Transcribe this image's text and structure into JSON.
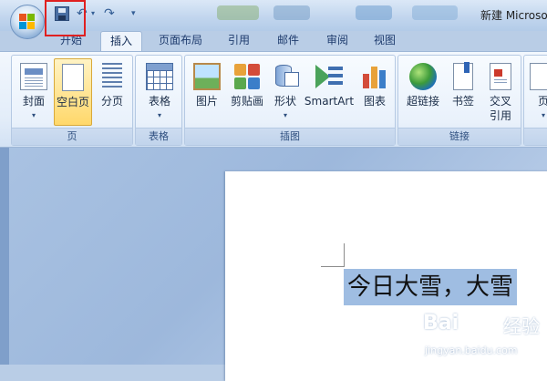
{
  "window": {
    "title": "新建 Microso"
  },
  "tabs": [
    {
      "label": "开始"
    },
    {
      "label": "插入"
    },
    {
      "label": "页面布局"
    },
    {
      "label": "引用"
    },
    {
      "label": "邮件"
    },
    {
      "label": "审阅"
    },
    {
      "label": "视图"
    }
  ],
  "active_tab": "插入",
  "ribbon": {
    "groups": [
      {
        "label": "页",
        "buttons": [
          "封面",
          "空白页",
          "分页"
        ]
      },
      {
        "label": "表格",
        "buttons": [
          "表格"
        ]
      },
      {
        "label": "插图",
        "buttons": [
          "图片",
          "剪贴画",
          "形状",
          "SmartArt",
          "图表"
        ]
      },
      {
        "label": "链接",
        "buttons": [
          "超链接",
          "书签",
          "交叉",
          "引用"
        ]
      },
      {
        "label": "",
        "buttons": [
          "页"
        ]
      }
    ]
  },
  "document": {
    "text": "今日大雪，大雪"
  },
  "watermark": {
    "logo": "Bai",
    "suffix": "经验",
    "url": "jingyan.baidu.com"
  },
  "colors": {
    "highlight_box": "#e02020",
    "selection": "#9fbde2",
    "active_button": "#ffd86b"
  },
  "icons": [
    "office-button-icon",
    "save-icon",
    "undo-icon",
    "redo-icon",
    "customize-qat-icon"
  ]
}
